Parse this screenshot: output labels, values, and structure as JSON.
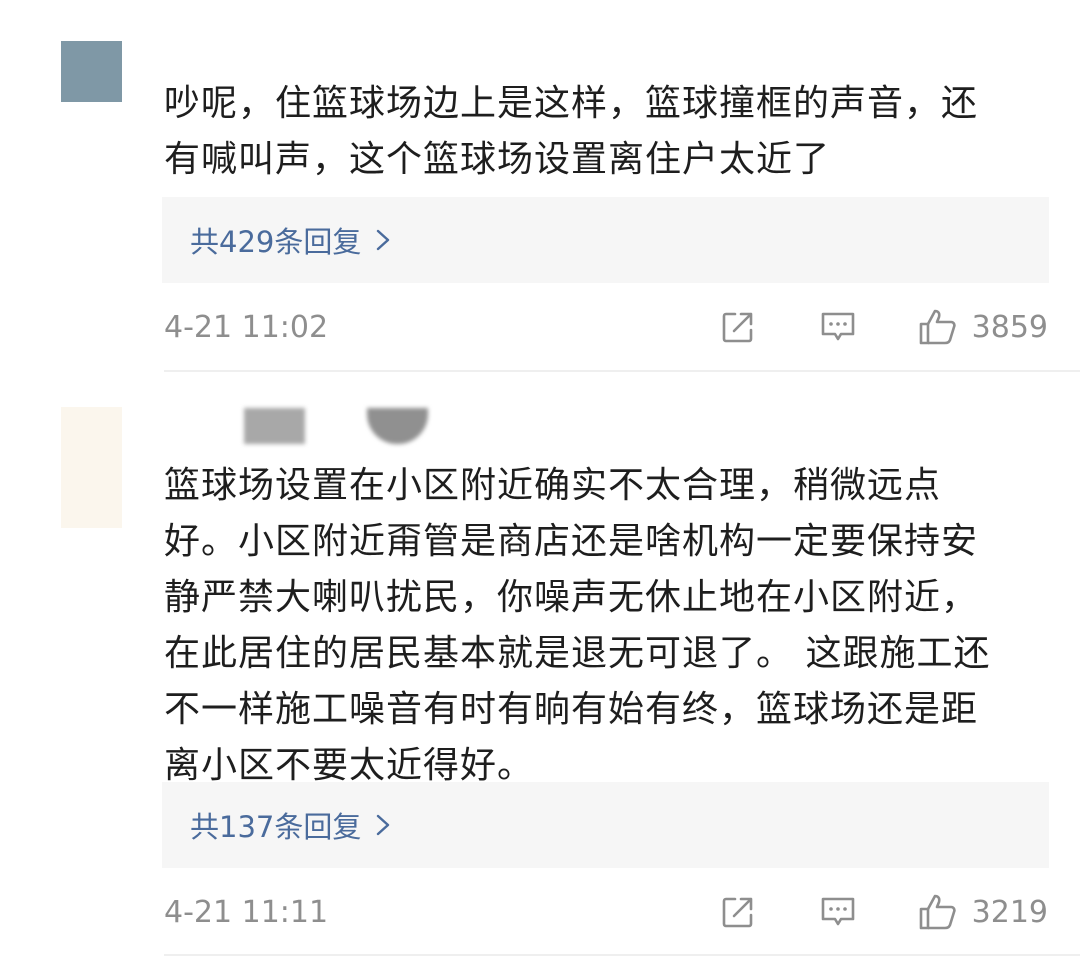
{
  "comments": [
    {
      "avatar_color": "#7f98a6",
      "text": "吵呢，住篮球场边上是这样，篮球撞框的声音，还\n有喊叫声，这个篮球场设置离住户太近了",
      "replies_label": "共429条回复",
      "timestamp": "4-21 11:02",
      "like_count": "3859"
    },
    {
      "avatar_color": "#fbf6ed",
      "text": "篮球场设置在小区附近确实不太合理，稍微远点\n好。小区附近甭管是商店还是啥机构一定要保持安\n静严禁大喇叭扰民，你噪声无休止地在小区附近，\n在此居住的居民基本就是退无可退了。 这跟施工还\n不一样施工噪音有时有晌有始有终，篮球场还是距\n离小区不要太近得好。",
      "replies_label": "共137条回复",
      "timestamp": "4-21 11:11",
      "like_count": "3219"
    }
  ],
  "icons": {
    "share": "share-icon",
    "comment": "comment-icon",
    "like": "like-icon",
    "chevron": "chevron-right-icon"
  },
  "colors": {
    "link": "#4a6b9c",
    "meta": "#8e8e8e",
    "text": "#1e1e1e",
    "reply_bg": "#f6f6f6"
  }
}
